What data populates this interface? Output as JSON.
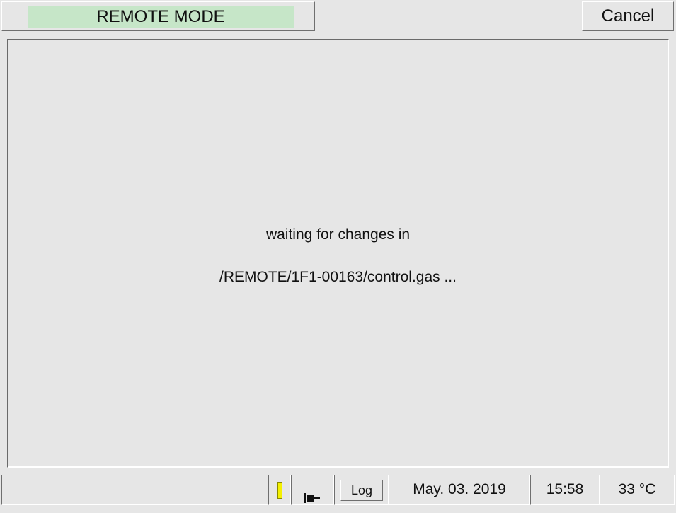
{
  "header": {
    "mode_label": "REMOTE MODE",
    "cancel_label": "Cancel"
  },
  "main": {
    "line1": "waiting for changes in",
    "line2": "/REMOTE/1F1-00163/control.gas ..."
  },
  "status_bar": {
    "info_text": "",
    "log_label": "Log",
    "date": "May. 03. 2019",
    "time": "15:58",
    "temperature": "33 °C",
    "indicator_color": "#f4f000",
    "indicator_icon": "yellow-indicator",
    "plug_icon": "plug-icon"
  },
  "colors": {
    "background": "#e6e6e6",
    "mode_highlight": "#c6e6c8"
  }
}
